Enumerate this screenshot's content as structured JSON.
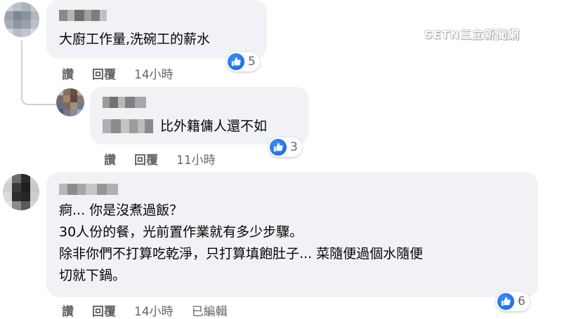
{
  "watermark": "SETN三立新聞網",
  "comments": [
    {
      "text": "大廚工作量,洗碗工的薪水",
      "actions": {
        "like": "讚",
        "reply": "回覆",
        "time": "14小時"
      },
      "likes": "5"
    },
    {
      "text": "比外籍傭人還不如",
      "actions": {
        "like": "讚",
        "reply": "回覆",
        "time": "11小時"
      },
      "likes": "3"
    },
    {
      "text": "痾... 你是沒煮過飯？\n30人份的餐，光前置作業就有多少步驟。\n除非你們不打算吃乾淨，只打算填飽肚子... 菜隨便過個水隨便\n切就下鍋。",
      "actions": {
        "like": "讚",
        "reply": "回覆",
        "time": "14小時",
        "edited": "已編輯"
      },
      "likes": "6"
    }
  ],
  "colors": {
    "bubble": "#f0f2f5",
    "like_blue": "#1877f2",
    "meta": "#65676b"
  }
}
